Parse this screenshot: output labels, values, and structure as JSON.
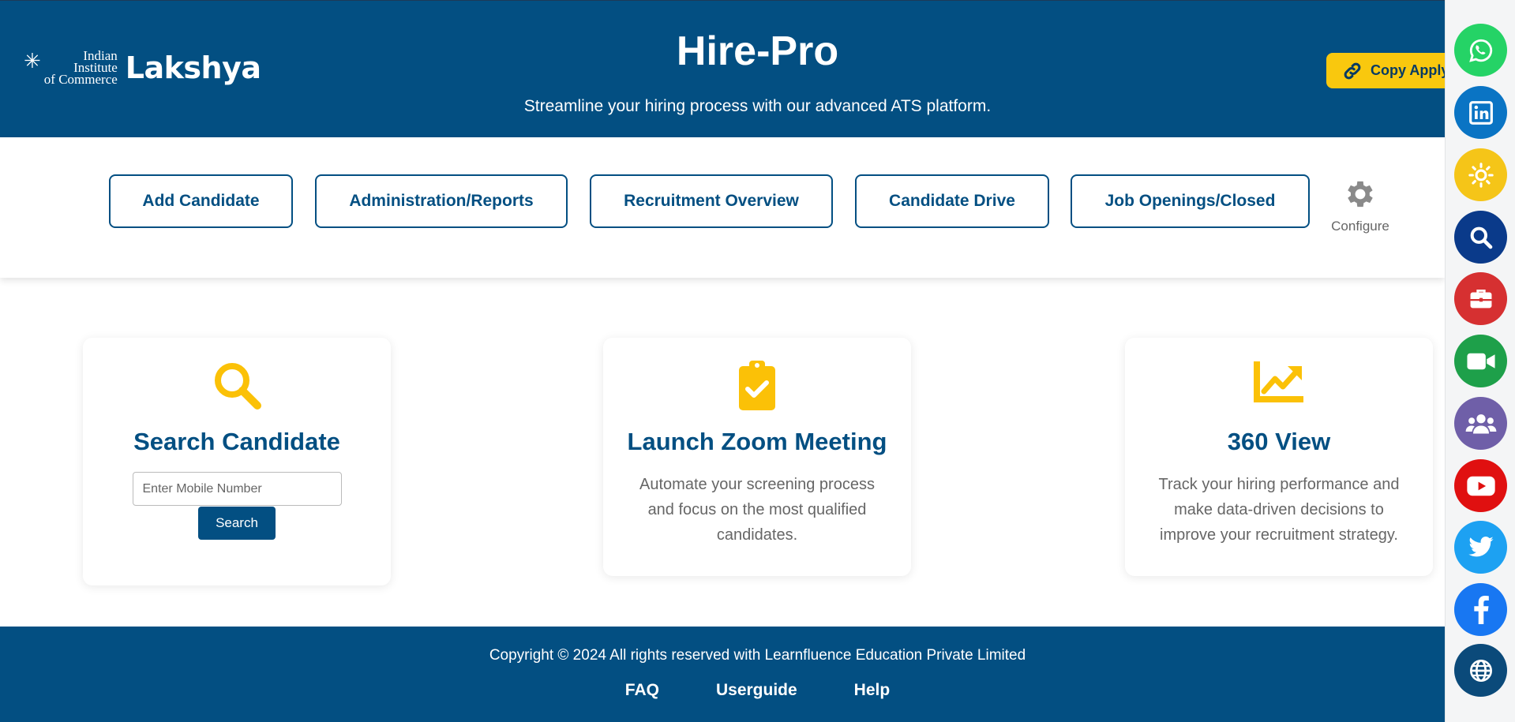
{
  "header": {
    "logo_iic_lines": [
      "Indian",
      "Institute",
      "of Commerce"
    ],
    "logo_lakshya": "Lakshya",
    "title": "Hire-Pro",
    "subtitle": "Streamline your hiring process with our advanced ATS platform.",
    "copy_apply_label": "Copy Apply Link"
  },
  "nav": {
    "buttons": [
      {
        "label": "Add Candidate"
      },
      {
        "label": "Administration/Reports"
      },
      {
        "label": "Recruitment Overview"
      },
      {
        "label": "Candidate Drive"
      },
      {
        "label": "Job Openings/Closed"
      }
    ],
    "configure_label": "Configure"
  },
  "cards": {
    "search": {
      "icon": "search-icon",
      "title": "Search Candidate",
      "input_placeholder": "Enter Mobile Number",
      "button_label": "Search"
    },
    "zoom": {
      "icon": "clipboard-check-icon",
      "title": "Launch Zoom Meeting",
      "description": "Automate your screening process and focus on the most qualified candidates."
    },
    "view360": {
      "icon": "chart-line-icon",
      "title": "360 View",
      "description": "Track your hiring performance and make data-driven decisions to improve your recruitment strategy."
    }
  },
  "footer": {
    "copyright": "Copyright © 2024 All rights reserved with Learnfluence Education Private Limited",
    "links": [
      "FAQ",
      "Userguide",
      "Help"
    ]
  },
  "social": [
    {
      "icon": "whatsapp-icon",
      "color": "#25d366"
    },
    {
      "icon": "linkedin-icon",
      "color": "#0a74c4"
    },
    {
      "icon": "sun-icon",
      "color": "#f5c518"
    },
    {
      "icon": "search-icon",
      "color": "#0a3a8a"
    },
    {
      "icon": "briefcase-icon",
      "color": "#d63031"
    },
    {
      "icon": "video-icon",
      "color": "#1ea04a"
    },
    {
      "icon": "users-icon",
      "color": "#6f5fa8"
    },
    {
      "icon": "youtube-icon",
      "color": "#e01010"
    },
    {
      "icon": "twitter-icon",
      "color": "#1da1f2"
    },
    {
      "icon": "facebook-icon",
      "color": "#1877f2"
    },
    {
      "icon": "globe-icon",
      "color": "#0b4a7a"
    }
  ],
  "colors": {
    "primary": "#034f82",
    "accent": "#f9c80e",
    "card_icon": "#fbc107"
  }
}
